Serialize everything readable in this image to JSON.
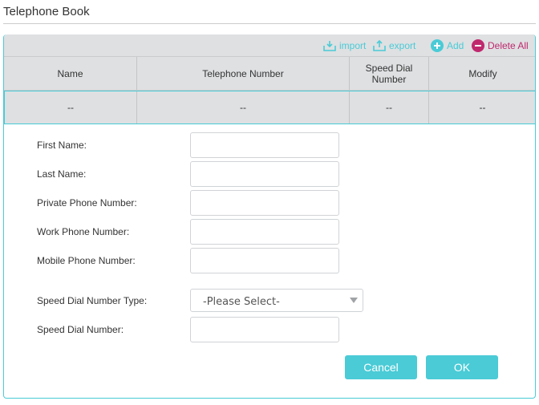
{
  "page": {
    "title": "Telephone Book"
  },
  "toolbar": {
    "import_label": "import",
    "export_label": "export",
    "add_label": "Add",
    "delete_all_label": "Delete All",
    "accent_color": "#4acbd6",
    "delete_color": "#c0286d"
  },
  "table": {
    "headers": [
      "Name",
      "Telephone Number",
      "Speed Dial Number",
      "Modify"
    ],
    "row": [
      "--",
      "--",
      "--",
      "--"
    ]
  },
  "form": {
    "first_name_label": "First Name:",
    "last_name_label": "Last Name:",
    "private_phone_label": "Private Phone Number:",
    "work_phone_label": "Work Phone Number:",
    "mobile_phone_label": "Mobile Phone Number:",
    "speed_dial_type_label": "Speed Dial Number Type:",
    "speed_dial_type_value": "-Please Select-",
    "speed_dial_number_label": "Speed Dial Number:",
    "first_name_value": "",
    "last_name_value": "",
    "private_phone_value": "",
    "work_phone_value": "",
    "mobile_phone_value": "",
    "speed_dial_number_value": ""
  },
  "buttons": {
    "cancel_label": "Cancel",
    "ok_label": "OK"
  }
}
